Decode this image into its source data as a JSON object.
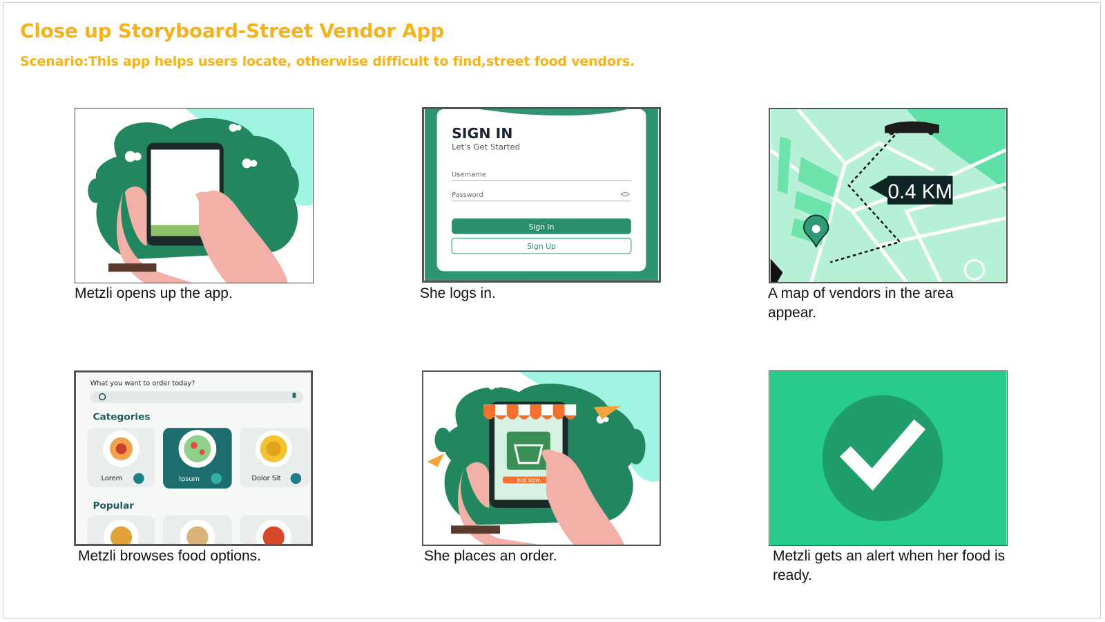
{
  "slide": {
    "title": "Close up Storyboard-Street Vendor App",
    "subtitle": "Scenario:This app helps users locate, otherwise difficult to find,street food vendors."
  },
  "panels": [
    {
      "caption": "Metzli opens up the app.",
      "image": "hand-holding-phone-illustration"
    },
    {
      "caption": "She logs in.",
      "image": "sign-in-screen",
      "screen": {
        "heading": "SIGN IN",
        "tagline": "Let's Get Started",
        "username_label": "Username",
        "password_label": "Password",
        "sign_in_button": "Sign In",
        "sign_up_button": "Sign Up"
      }
    },
    {
      "caption": "A map of vendors in the area appear.",
      "image": "map-route",
      "screen": {
        "distance": "0.4 KM"
      }
    },
    {
      "caption": "Metzli browses food options.",
      "image": "food-categories-screen",
      "screen": {
        "prompt": "What you want to order today?",
        "categories_heading": "Categories",
        "categories": [
          "Lorem",
          "Ipsum",
          "Dolor Sit"
        ],
        "popular_heading": "Popular"
      }
    },
    {
      "caption": "She places an order.",
      "image": "online-shop-phone-illustration",
      "screen": {
        "buy_label": "BUE NOW"
      }
    },
    {
      "caption": "Metzli gets an alert when her food is ready.",
      "image": "check-mark-alert"
    }
  ],
  "colors": {
    "accent": "#f6b21b",
    "green": "#1f8f63",
    "mint": "#9ff5e2",
    "alert_bg": "#27cc8a"
  }
}
